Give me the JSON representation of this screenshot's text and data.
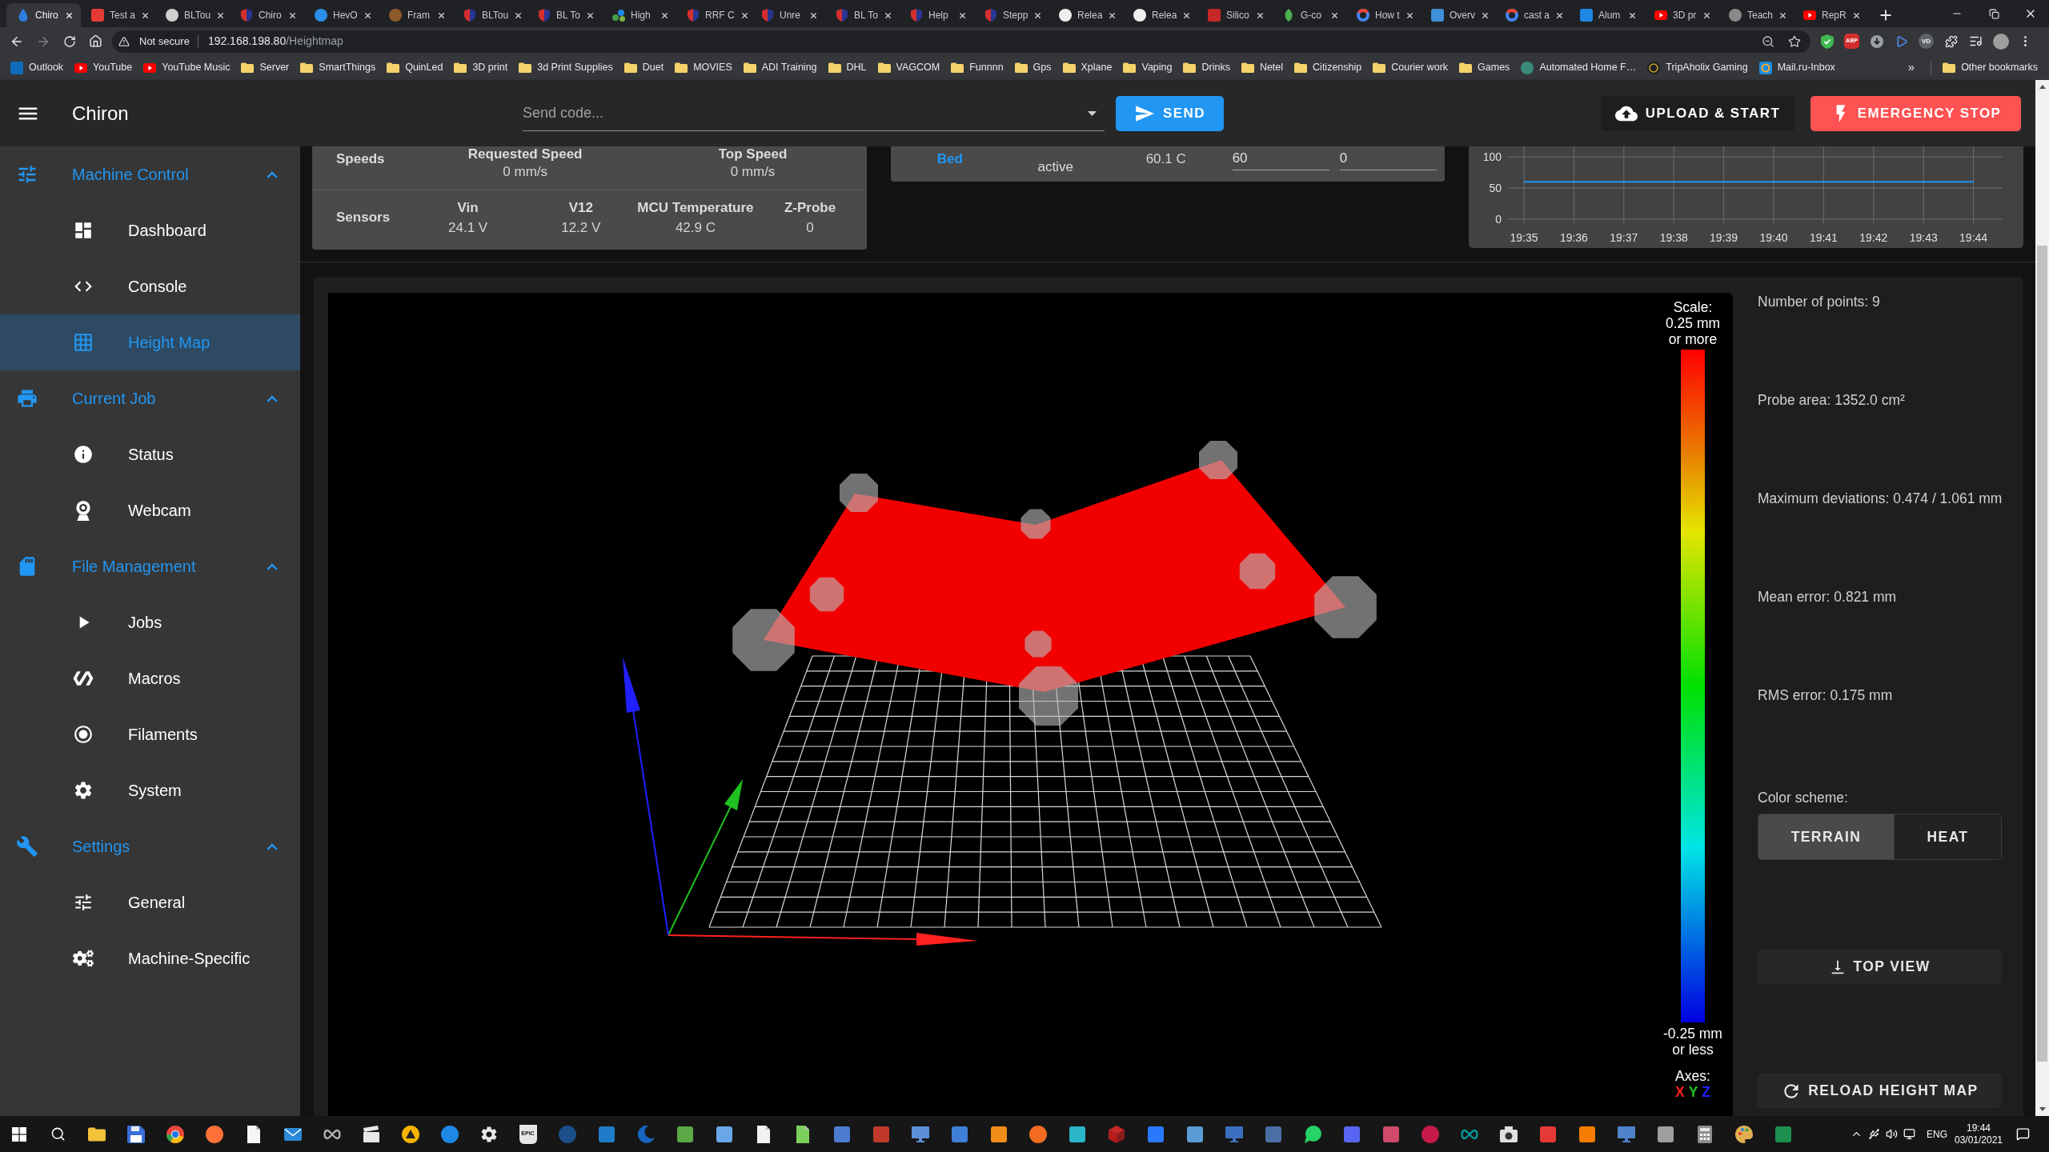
{
  "browser": {
    "tabs": [
      {
        "title": "Chiro",
        "selected": true
      },
      {
        "title": "Test a",
        "selected": false
      },
      {
        "title": "BLTou",
        "selected": false
      },
      {
        "title": "Chiro",
        "selected": false
      },
      {
        "title": "HevO",
        "selected": false
      },
      {
        "title": "Fram",
        "selected": false
      },
      {
        "title": "BLTou",
        "selected": false
      },
      {
        "title": "BL To",
        "selected": false
      },
      {
        "title": "High",
        "selected": false
      },
      {
        "title": "RRF C",
        "selected": false
      },
      {
        "title": "Unre",
        "selected": false
      },
      {
        "title": "BL To",
        "selected": false
      },
      {
        "title": "Help",
        "selected": false
      },
      {
        "title": "Stepp",
        "selected": false
      },
      {
        "title": "Relea",
        "selected": false
      },
      {
        "title": "Relea",
        "selected": false
      },
      {
        "title": "Silico",
        "selected": false
      },
      {
        "title": "G-co",
        "selected": false
      },
      {
        "title": "How t",
        "selected": false
      },
      {
        "title": "Overv",
        "selected": false
      },
      {
        "title": "cast a",
        "selected": false
      },
      {
        "title": "Alum",
        "selected": false
      },
      {
        "title": "3D pr",
        "selected": false
      },
      {
        "title": "Teach",
        "selected": false
      },
      {
        "title": "RepR",
        "selected": false
      }
    ],
    "address": {
      "security": "Not secure",
      "host": "192.168.198.80",
      "path": "/Heightmap"
    },
    "extension_badges": [
      "ABP",
      "VD"
    ],
    "bookmarks": [
      "Outlook",
      "YouTube",
      "YouTube Music",
      "Server",
      "SmartThings",
      "QuinLed",
      "3D print",
      "3d Print Supplies",
      "Duet",
      "MOVIES",
      "ADI Training",
      "DHL",
      "VAGCOM",
      "Funnnn",
      "Gps",
      "Xplane",
      "Vaping",
      "Drinks",
      "Netel",
      "Citizenship",
      "Courier work",
      "Games",
      "Automated Home F…",
      "TripAholix Gaming",
      "Mail.ru-Inbox"
    ],
    "bookmarks_overflow": "»",
    "other_bookmarks": "Other bookmarks"
  },
  "app_bar": {
    "title": "Chiron",
    "code_field": {
      "placeholder": "Send code..."
    },
    "send_button": "SEND",
    "upload_button": "UPLOAD & START",
    "emergency_button": "EMERGENCY STOP"
  },
  "sidebar": [
    {
      "label": "Machine Control",
      "expanded": true,
      "items": [
        {
          "label": "Dashboard",
          "selected": false
        },
        {
          "label": "Console",
          "selected": false
        },
        {
          "label": "Height Map",
          "selected": true
        }
      ]
    },
    {
      "label": "Current Job",
      "expanded": true,
      "items": [
        {
          "label": "Status",
          "selected": false
        },
        {
          "label": "Webcam",
          "selected": false
        }
      ]
    },
    {
      "label": "File Management",
      "expanded": true,
      "items": [
        {
          "label": "Jobs",
          "selected": false
        },
        {
          "label": "Macros",
          "selected": false
        },
        {
          "label": "Filaments",
          "selected": false
        },
        {
          "label": "System",
          "selected": false
        }
      ]
    },
    {
      "label": "Settings",
      "expanded": true,
      "items": [
        {
          "label": "General",
          "selected": false
        },
        {
          "label": "Machine-Specific",
          "selected": false
        }
      ]
    }
  ],
  "status_panel": {
    "rows": [
      {
        "label": "Speeds",
        "cells": [
          {
            "heading": "Requested Speed",
            "value": "0 mm/s"
          },
          {
            "heading": "Top Speed",
            "value": "0 mm/s"
          }
        ]
      },
      {
        "label": "Sensors",
        "cells": [
          {
            "heading": "Vin",
            "value": "24.1 V"
          },
          {
            "heading": "V12",
            "value": "12.2 V"
          },
          {
            "heading": "MCU Temperature",
            "value": "42.9 C"
          },
          {
            "heading": "Z-Probe",
            "value": "0"
          }
        ]
      }
    ]
  },
  "tools_panel": {
    "heater": {
      "name": "Bed",
      "state": "active",
      "current": "60.1 C",
      "active_value": "60",
      "standby_value": "0"
    }
  },
  "temperature_chart": {
    "chart_data": {
      "type": "line",
      "x": [
        "19:35",
        "19:36",
        "19:37",
        "19:38",
        "19:39",
        "19:40",
        "19:41",
        "19:42",
        "19:43",
        "19:44"
      ],
      "values": [
        60,
        60,
        60,
        60,
        60,
        60,
        60,
        60,
        60,
        60
      ],
      "ylim": [
        0,
        100
      ],
      "yticks": [
        0,
        50,
        100
      ],
      "grid": true
    }
  },
  "height_map": {
    "scale": {
      "title": "Scale:",
      "max_label": "0.25 mm or more",
      "min_label": "-0.25 mm or less",
      "axes_title": "Axes:",
      "axes": [
        {
          "label": "X",
          "color": "#ff2020"
        },
        {
          "label": "Y",
          "color": "#20c020"
        },
        {
          "label": "Z",
          "color": "#2020ff"
        }
      ]
    },
    "stats": [
      "Number of points: 9",
      "Probe area: 1352.0 cm²",
      "Maximum deviations: 0.474 / 1.061 mm",
      "Mean error: 0.821 mm",
      "RMS error: 0.175 mm"
    ],
    "color_scheme": {
      "label": "Color scheme:",
      "options": [
        {
          "label": "TERRAIN",
          "selected": true
        },
        {
          "label": "HEAT",
          "selected": false
        }
      ]
    },
    "top_view_button": "TOP VIEW",
    "reload_button": "RELOAD HEIGHT MAP"
  },
  "taskbar": {
    "launcher_label": "EPIC",
    "language": "ENG",
    "time": "19:44",
    "date": "03/01/2021"
  }
}
